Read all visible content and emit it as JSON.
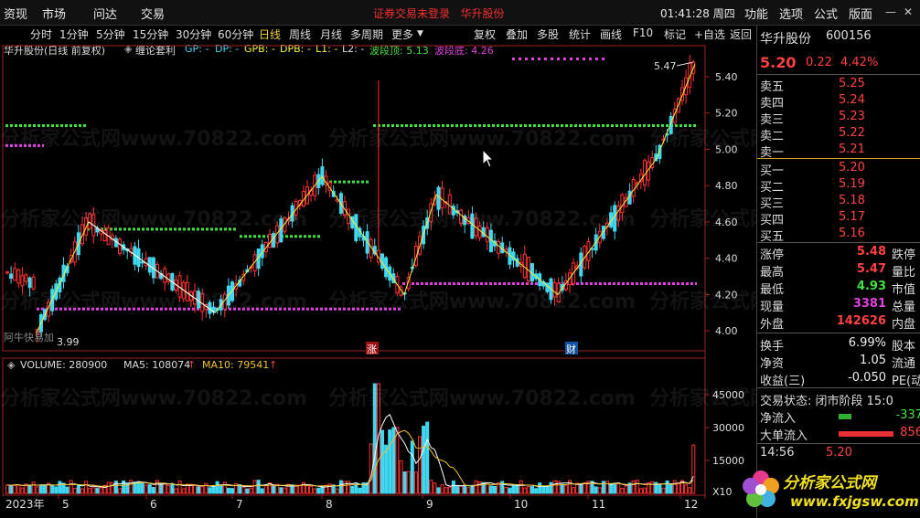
{
  "menu": {
    "items": [
      "资现",
      "市场",
      "问达",
      "交易"
    ],
    "title": "证券交易未登录",
    "stock": "华升股份",
    "clock": "01:41:28 周四",
    "right_items": [
      "功能",
      "选项",
      "公式",
      "版面"
    ]
  },
  "toolbar": {
    "periods": [
      "分时",
      "1分钟",
      "5分钟",
      "15分钟",
      "30分钟",
      "60分钟",
      "日线",
      "周线",
      "月线",
      "多周期",
      "更多"
    ],
    "active": "日线",
    "tools": [
      "复权",
      "叠加",
      "多股",
      "统计",
      "画线",
      "F10",
      "标记",
      "+自选",
      "返回"
    ]
  },
  "chart": {
    "stock_label": "华升股份(日线 前复权)",
    "formula": "缠论套利",
    "gp": "GP: -",
    "dp": "DP: -",
    "gpb": "GPB: -",
    "dpb": "DPB: -",
    "l1": "L1: -",
    "l2": "L2: -",
    "top_label": "波段顶: 5.13",
    "bottom_label": "波段底: 4.26",
    "high_mark": "5.47",
    "low_mark": "3.99",
    "annot_zhang": "涨",
    "annot_cai": "财",
    "small_label": "阿牛快易加",
    "price_ticks": [
      "5.40",
      "5.20",
      "5.00",
      "4.80",
      "4.60",
      "4.40",
      "4.20",
      "4.00"
    ],
    "volume_label": "VOLUME: 280900",
    "ma5": "MA5: 108074",
    "ma10": "MA10: 79541",
    "vol_ticks": [
      "45000",
      "30000",
      "15000"
    ],
    "vol_unit": "X10",
    "x_labels": [
      "2023年",
      "5",
      "6",
      "7",
      "8",
      "9",
      "10",
      "11",
      "12"
    ]
  },
  "chart_data": {
    "type": "candlestick",
    "yrange": [
      3.9,
      5.5
    ],
    "top_level": 5.13,
    "bottom_level": 4.26,
    "swing": [
      [
        40,
        3.99
      ],
      [
        97,
        4.6
      ],
      [
        235,
        4.1
      ],
      [
        352,
        4.85
      ],
      [
        442,
        4.2
      ],
      [
        477,
        4.75
      ],
      [
        610,
        4.2
      ],
      [
        718,
        4.95
      ],
      [
        760,
        5.47
      ]
    ],
    "colors": {
      "up": "#ff3030",
      "down": "#40d8f0",
      "top": "#40e040",
      "bottom": "#e040e0",
      "swing": "#f0f040"
    }
  },
  "quote": {
    "name": "华升股份",
    "code": "600156",
    "price": "5.20",
    "change": "0.22",
    "pct": "4.42%",
    "asks": [
      {
        "label": "卖五",
        "price": "5.25"
      },
      {
        "label": "卖四",
        "price": "5.24"
      },
      {
        "label": "卖三",
        "price": "5.23"
      },
      {
        "label": "卖二",
        "price": "5.22"
      },
      {
        "label": "卖一",
        "price": "5.21"
      }
    ],
    "bids": [
      {
        "label": "买一",
        "price": "5.20"
      },
      {
        "label": "买二",
        "price": "5.19"
      },
      {
        "label": "买三",
        "price": "5.18"
      },
      {
        "label": "买四",
        "price": "5.17"
      },
      {
        "label": "买五",
        "price": "5.16"
      }
    ],
    "stats": [
      {
        "label": "涨停",
        "value": "5.48",
        "color": "red",
        "label2": "跌停"
      },
      {
        "label": "最高",
        "value": "5.47",
        "color": "red",
        "label2": "量比"
      },
      {
        "label": "最低",
        "value": "4.93",
        "color": "grn",
        "label2": "市值"
      },
      {
        "label": "现量",
        "value": "3381",
        "color": "mag",
        "label2": "总量"
      },
      {
        "label": "外盘",
        "value": "142626",
        "color": "red",
        "label2": "内盘"
      }
    ],
    "stats2": [
      {
        "label": "换手",
        "value": "6.99%",
        "label2": "股本"
      },
      {
        "label": "净资",
        "value": "1.05",
        "label2": "流通"
      },
      {
        "label": "收益(三)",
        "value": "-0.050",
        "label2": "PE(动)"
      }
    ],
    "trade_status": "交易状态: 闭市阶段 15:0",
    "net_inflow_label": "净流入",
    "net_inflow": "-337",
    "big_inflow_label": "大单流入",
    "big_inflow": "856",
    "time": "14:56",
    "time_price": "5.20"
  },
  "branding": {
    "site": "分析家公式网",
    "url": "www.fxjgsw.com"
  }
}
